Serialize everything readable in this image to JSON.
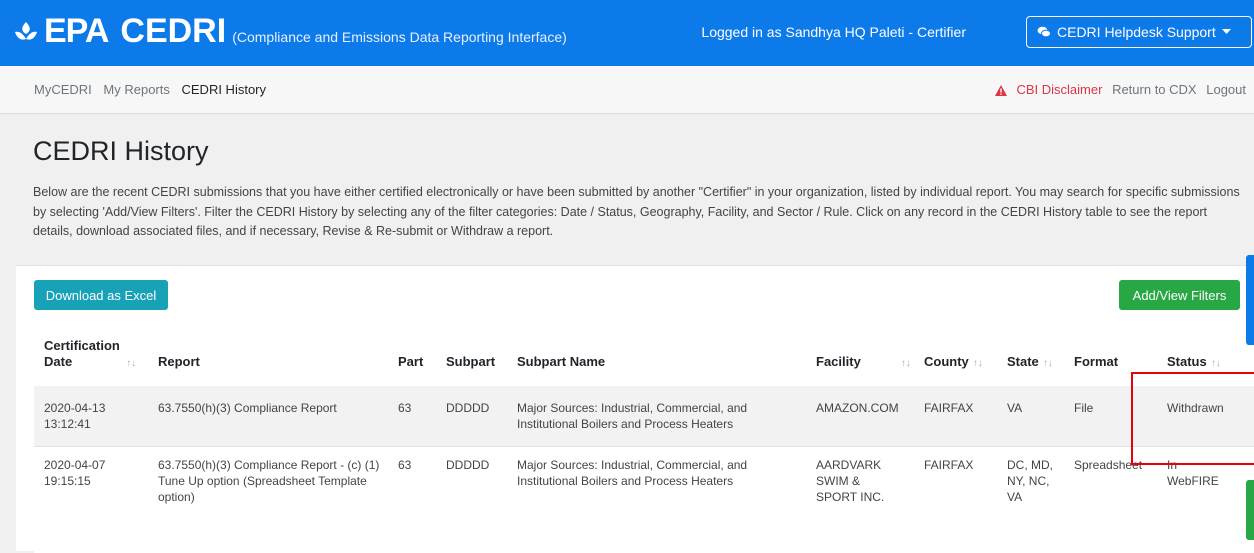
{
  "header": {
    "logo_text": "EPA",
    "app_name": "CEDRI",
    "tagline": "(Compliance and Emissions Data Reporting Interface)",
    "logged_in": "Logged in as Sandhya HQ Paleti - Certifier",
    "help_label": "CEDRI Helpdesk Support"
  },
  "nav": {
    "items": [
      "MyCEDRI",
      "My Reports",
      "CEDRI History"
    ],
    "cbi": "CBI Disclaimer",
    "return": "Return to CDX",
    "logout": "Logout"
  },
  "page": {
    "title": "CEDRI History",
    "intro": "Below are the recent CEDRI submissions that you have either certified electronically or have been submitted by another \"Certifier\" in your organization, listed by individual report. You may search for specific submissions by selecting 'Add/View Filters'. Filter the CEDRI History by selecting any of the filter categories: Date / Status, Geography, Facility, and Sector / Rule. Click on any record in the CEDRI History table to see the report details, download associated files, and if necessary, Revise & Re-submit or Withdraw a report."
  },
  "toolbar": {
    "excel": "Download as Excel",
    "filters": "Add/View Filters"
  },
  "table": {
    "headers": {
      "cert_date_1": "Certification",
      "cert_date_2": "Date",
      "report": "Report",
      "part": "Part",
      "subpart": "Subpart",
      "subpart_name": "Subpart Name",
      "facility": "Facility",
      "county": "County",
      "state": "State",
      "format": "Format",
      "status": "Status"
    },
    "rows": [
      {
        "date": "2020-04-13",
        "time": "13:12:41",
        "report": "63.7550(h)(3) Compliance Report",
        "part": "63",
        "subpart": "DDDDD",
        "subpart_name": "Major Sources: Industrial, Commercial, and Institutional Boilers and Process Heaters",
        "facility": "AMAZON.COM",
        "county": "FAIRFAX",
        "state": "VA",
        "format": "File",
        "status": "Withdrawn"
      },
      {
        "date": "2020-04-07",
        "time": "19:15:15",
        "report": "63.7550(h)(3) Compliance Report - (c) (1) Tune Up option (Spreadsheet Template option)",
        "part": "63",
        "subpart": "DDDDD",
        "subpart_name": "Major Sources: Industrial, Commercial, and Institutional Boilers and Process Heaters",
        "facility": "AARDVARK SWIM & SPORT INC.",
        "county": "FAIRFAX",
        "state": "DC, MD, NY, NC, VA",
        "format": "Spreadsheet",
        "status": "In WebFIRE"
      }
    ]
  },
  "colors": {
    "primary": "#0d7aea",
    "excel": "#17a2b8",
    "filters": "#28a745",
    "danger": "#dc3545"
  }
}
